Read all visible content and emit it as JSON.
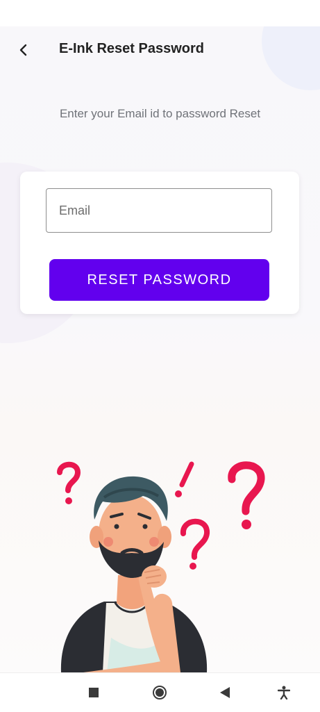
{
  "header": {
    "title": "E-Ink Reset Password",
    "back_icon": "chevron-left-icon"
  },
  "subtitle": "Enter your Email id to password Reset",
  "form": {
    "email_placeholder": "Email",
    "email_value": "",
    "reset_button_label": "RESET PASSWORD"
  },
  "colors": {
    "primary": "#6200ee",
    "accent_question": "#e8174f"
  },
  "illustration": {
    "description_icon": "confused-man-with-question-marks-illustration"
  },
  "nav_bar": {
    "items": [
      "recent-apps-icon",
      "home-icon",
      "back-icon",
      "accessibility-icon"
    ]
  }
}
